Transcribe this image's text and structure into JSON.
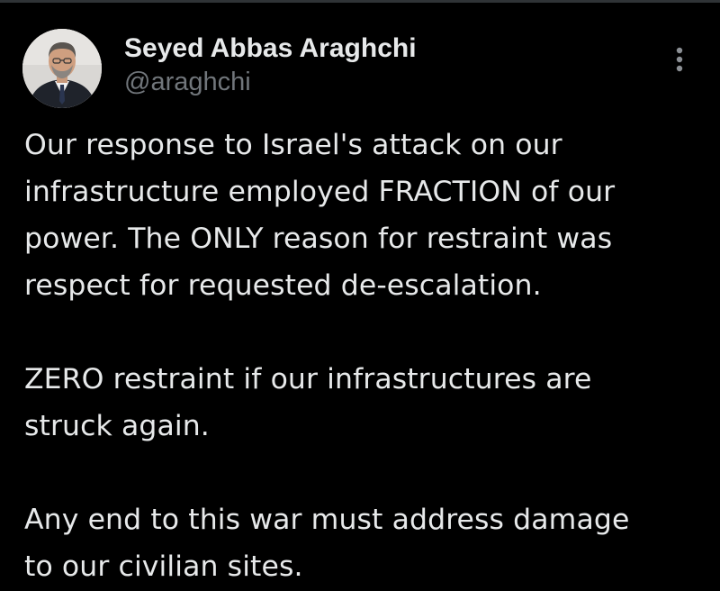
{
  "tweet": {
    "author": {
      "name": "Seyed Abbas Araghchi",
      "handle": "@araghchi"
    },
    "paragraphs": [
      [
        "Our response to Israel's attack on our",
        "infrastructure employed FRACTION of our",
        "power. The ONLY reason for restraint was",
        "respect for requested de-escalation."
      ],
      [
        "ZERO restraint if our infrastructures are",
        "struck again."
      ],
      [
        "Any end to this war must address damage",
        "to our civilian sites."
      ]
    ]
  },
  "icons": {
    "menu": "more-vertical-icon",
    "avatar": "profile-photo"
  },
  "colors": {
    "background": "#000000",
    "text_primary": "#e7e9ea",
    "text_secondary": "#71767b"
  }
}
